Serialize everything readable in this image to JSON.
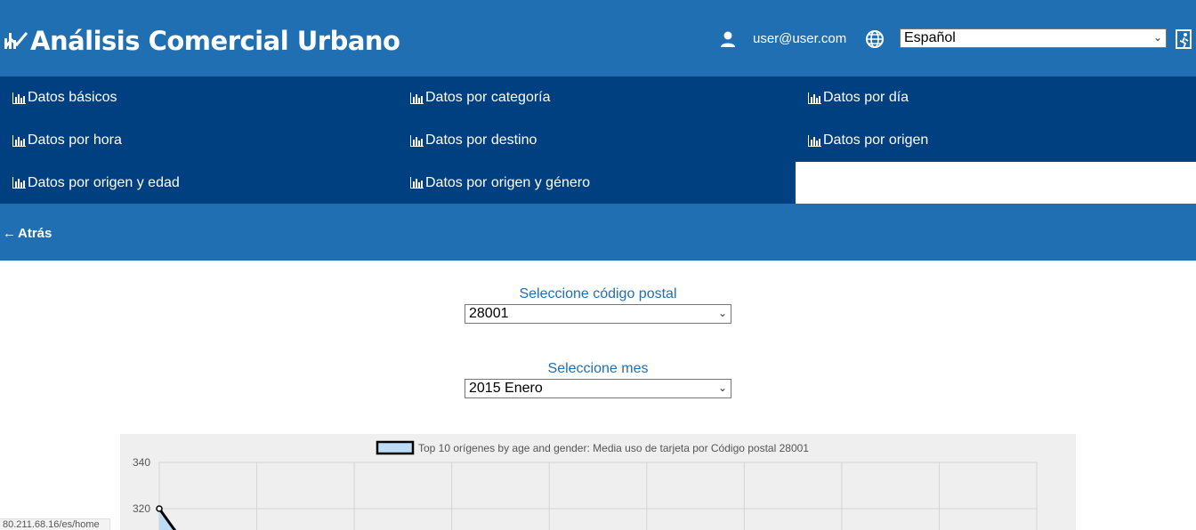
{
  "app": {
    "title": "Análisis Comercial Urbano",
    "user_email": "user@user.com",
    "language": "Español"
  },
  "icons": {
    "brand": "chart-line-icon",
    "user": "user-icon",
    "globe": "globe-icon",
    "exit": "exit-icon",
    "nav": "bar-chart-icon",
    "back": "arrow-left-icon"
  },
  "colors": {
    "header": "#1f6fb2",
    "nav": "#004080",
    "label": "#1f6fb2",
    "chart_bg": "#efefef",
    "series_fill": "#bcdcf5",
    "series_line": "#000000"
  },
  "nav": {
    "items": [
      {
        "label": "Datos básicos"
      },
      {
        "label": "Datos por categoría"
      },
      {
        "label": "Datos por día"
      },
      {
        "label": "Datos por hora"
      },
      {
        "label": "Datos por destino"
      },
      {
        "label": "Datos por origen"
      },
      {
        "label": "Datos por origen y edad"
      },
      {
        "label": "Datos por origen y género"
      }
    ]
  },
  "back": {
    "label": "Atrás"
  },
  "form": {
    "postal_label": "Seleccione código postal",
    "postal_value": "28001",
    "month_label": "Seleccione mes",
    "month_value": "2015 Enero"
  },
  "chart_data": {
    "type": "line",
    "legend": "Top 10 orígenes by age and gender: Media uso de tarjeta por Código postal 28001",
    "legend_placement": "top",
    "y_ticks": [
      "340",
      "320"
    ],
    "ylim": [
      320,
      340
    ],
    "grid": true,
    "series": [
      {
        "name": "Top 10 orígenes by age and gender: Media uso de tarjeta por Código postal 28001",
        "values": [
          320
        ]
      }
    ]
  },
  "status_url": "80.211.68.16/es/home"
}
